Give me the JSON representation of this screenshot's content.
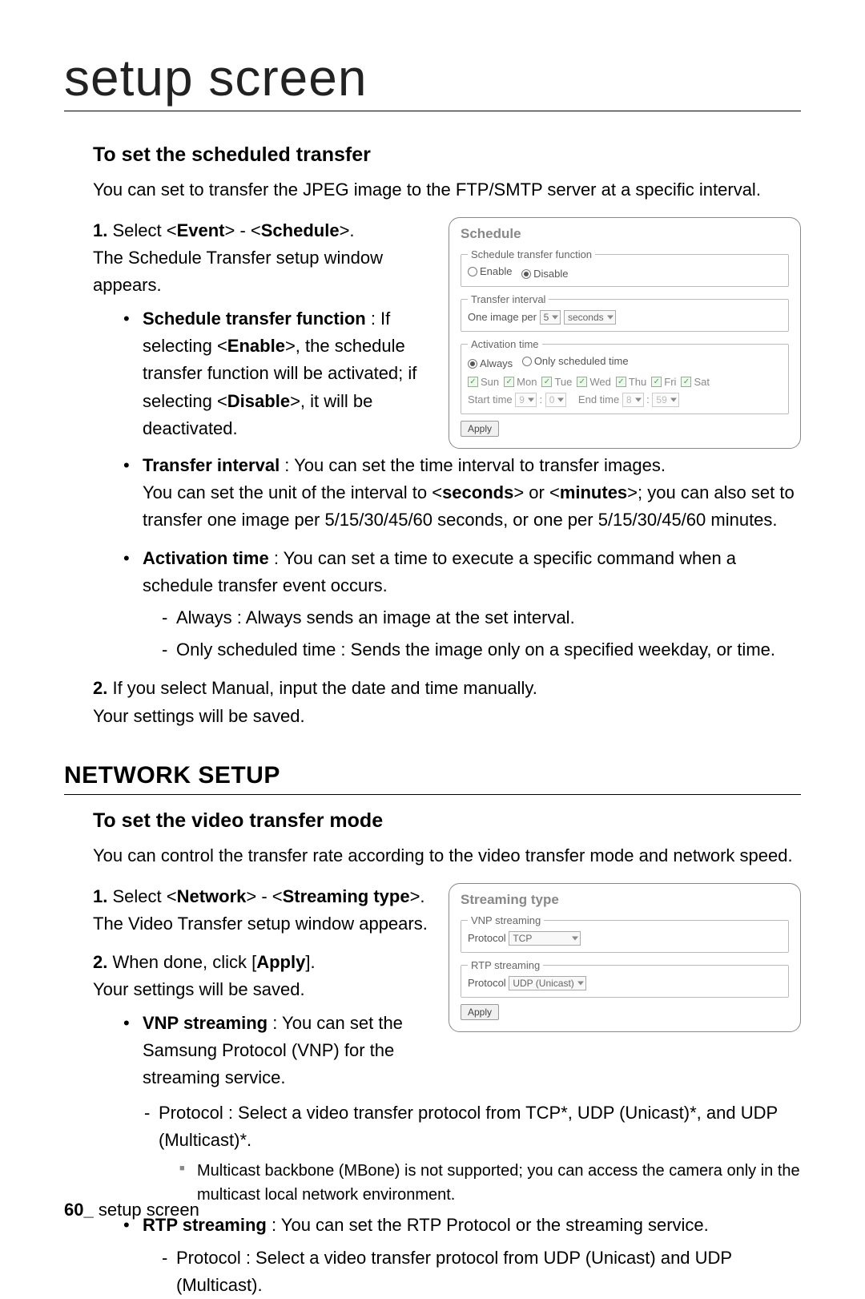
{
  "page": {
    "title": "setup screen",
    "footer_page": "60_",
    "footer_label": "setup screen"
  },
  "sec1": {
    "heading": "To set the scheduled transfer",
    "intro": "You can set to transfer the JPEG image to the FTP/SMTP server at a specific interval.",
    "step1_pre": "Select <",
    "step1_b1": "Event",
    "step1_mid": "> - <",
    "step1_b2": "Schedule",
    "step1_post": ">.",
    "step1_line2": "The Schedule Transfer setup window appears.",
    "b1_title": "Schedule transfer function",
    "b1_text_a": " : If selecting <",
    "b1_en": "Enable",
    "b1_text_b": ">, the schedule transfer function will be activated; if selecting <",
    "b1_dis": "Disable",
    "b1_text_c": ">, it will be deactivated.",
    "b2_title": "Transfer interval",
    "b2_text_a": " : You can set the time interval to transfer images.",
    "b2_text_b_a": "You can set the unit of the interval to <",
    "b2_sec": "seconds",
    "b2_text_b_b": "> or <",
    "b2_min": "minutes",
    "b2_text_b_c": ">; you can also set to transfer one image per 5/15/30/45/60 seconds, or one per 5/15/30/45/60 minutes.",
    "b3_title": "Activation time",
    "b3_text": " : You can set a time to execute a specific command when a schedule transfer event occurs.",
    "b3_d1": "Always : Always sends an image at the set interval.",
    "b3_d2": "Only scheduled time : Sends the image only on a specified weekday, or time.",
    "step2_a": "If you select Manual, input the date and time manually.",
    "step2_b": "Your settings will be saved."
  },
  "panel1": {
    "title": "Schedule",
    "fs1_legend": "Schedule transfer function",
    "enable": "Enable",
    "disable": "Disable",
    "fs2_legend": "Transfer interval",
    "one_image_per": "One image per",
    "interval_val": "5",
    "interval_unit": "seconds",
    "fs3_legend": "Activation time",
    "always": "Always",
    "only": "Only scheduled time",
    "days": [
      "Sun",
      "Mon",
      "Tue",
      "Wed",
      "Thu",
      "Fri",
      "Sat"
    ],
    "start_label": "Start time",
    "start_h": "9",
    "start_m": "0",
    "end_label": "End time",
    "end_h": "8",
    "end_m": "59",
    "apply": "Apply"
  },
  "net": {
    "heading": "NETWORK SETUP",
    "sub": "To set the video transfer mode",
    "intro": "You can control the transfer rate according to the video transfer mode and network speed.",
    "s1_pre": "Select <",
    "s1_b1": "Network",
    "s1_mid": "> - <",
    "s1_b2": "Streaming type",
    "s1_post": ">.",
    "s1_l2": "The Video Transfer setup window appears.",
    "s2_a": "When done, click [",
    "s2_apply": "Apply",
    "s2_b": "].",
    "s2_l2": "Your settings will be saved.",
    "v_title": "VNP streaming",
    "v_text": " : You can set the Samsung Protocol (VNP) for the streaming service.",
    "v_d1": "Protocol : Select a video transfer protocol from TCP*, UDP (Unicast)*, and UDP (Multicast)*.",
    "v_note": "Multicast backbone (MBone) is not supported; you can access the camera only in the multicast local network environment.",
    "r_title": "RTP streaming",
    "r_text": " : You can set the RTP Protocol or the streaming service.",
    "r_d1": "Protocol : Select a video transfer protocol from UDP (Unicast) and UDP (Multicast)."
  },
  "panel2": {
    "title": "Streaming type",
    "vnp_legend": "VNP streaming",
    "protocol": "Protocol",
    "vnp_val": "TCP",
    "rtp_legend": "RTP streaming",
    "rtp_val": "UDP (Unicast)",
    "apply": "Apply"
  }
}
